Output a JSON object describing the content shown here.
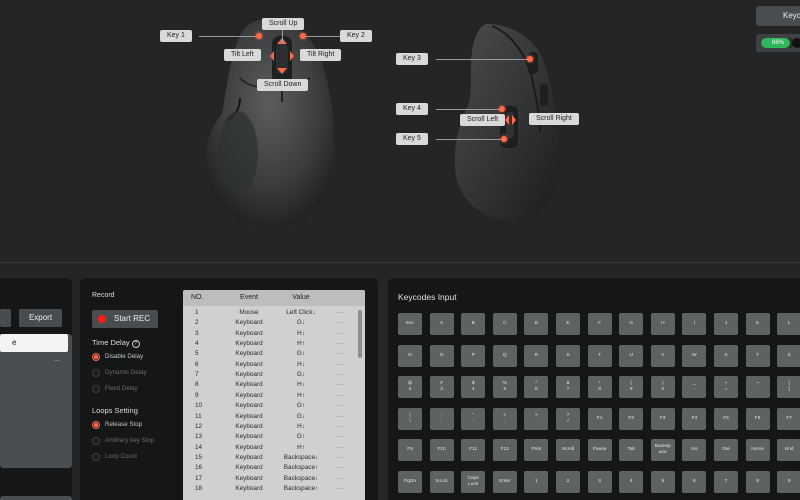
{
  "mouse_top": {
    "labels": {
      "scroll_up": "Scroll Up",
      "key1": "Key 1",
      "key2": "Key 2",
      "tilt_left": "Tilt Left",
      "tilt_right": "Tilt Right",
      "scroll_down": "Scroll Down"
    }
  },
  "mouse_side": {
    "labels": {
      "key3": "Key 3",
      "key4": "Key 4",
      "key5": "Key 5",
      "scroll_left": "Scroll Left",
      "scroll_right": "Scroll Right"
    }
  },
  "top_right": {
    "button_label": "Keyc",
    "battery": {
      "percent_text": "86%",
      "level": 0.86,
      "color": "#2eb85c"
    }
  },
  "left_panel": {
    "export_label": "Export",
    "selected_item": "e",
    "dots": "..."
  },
  "record": {
    "title": "Record",
    "start_label": "Start REC",
    "time_delay_title": "Time Delay",
    "time_delay_options": [
      "Disable Delay",
      "Dynamic Delay",
      "Fixed Delay"
    ],
    "loops_title": "Loops Setting",
    "loops_options": [
      "Release Stop",
      "Arbitrary key Stop",
      "Loop Count"
    ],
    "accent": "#ff6a4a"
  },
  "macro_table": {
    "headers": {
      "no": "NO.",
      "event": "Event",
      "value": "Value"
    },
    "rows": [
      {
        "no": "1",
        "event": "Mouse",
        "value": "Left Click↓",
        "more": "···"
      },
      {
        "no": "2",
        "event": "Keyboard",
        "value": "G↓",
        "more": "···"
      },
      {
        "no": "3",
        "event": "Keyboard",
        "value": "H↓",
        "more": "···"
      },
      {
        "no": "4",
        "event": "Keyboard",
        "value": "H↑",
        "more": "···"
      },
      {
        "no": "5",
        "event": "Keyboard",
        "value": "G↑",
        "more": "···"
      },
      {
        "no": "6",
        "event": "Keyboard",
        "value": "H↓",
        "more": "···"
      },
      {
        "no": "7",
        "event": "Keyboard",
        "value": "G↓",
        "more": "···"
      },
      {
        "no": "8",
        "event": "Keyboard",
        "value": "H↓",
        "more": "···"
      },
      {
        "no": "9",
        "event": "Keyboard",
        "value": "H↑",
        "more": "···"
      },
      {
        "no": "10",
        "event": "Keyboard",
        "value": "G↑",
        "more": "···"
      },
      {
        "no": "11",
        "event": "Keyboard",
        "value": "G↓",
        "more": "···"
      },
      {
        "no": "12",
        "event": "Keyboard",
        "value": "H↓",
        "more": "···"
      },
      {
        "no": "13",
        "event": "Keyboard",
        "value": "G↑",
        "more": "···"
      },
      {
        "no": "14",
        "event": "Keyboard",
        "value": "H↑",
        "more": "···"
      },
      {
        "no": "15",
        "event": "Keyboard",
        "value": "Backspace↓",
        "more": "···"
      },
      {
        "no": "16",
        "event": "Keyboard",
        "value": "Backspace↑",
        "more": "···"
      },
      {
        "no": "17",
        "event": "Keyboard",
        "value": "Backspace↓",
        "more": "···"
      },
      {
        "no": "18",
        "event": "Keyboard",
        "value": "Backspace↑",
        "more": "···"
      }
    ]
  },
  "keycodes": {
    "title": "Keycodes Input",
    "rows": [
      [
        "Esc",
        "A",
        "B",
        "C",
        "D",
        "E",
        "F",
        "G",
        "H",
        "I",
        "J",
        "K",
        "L"
      ],
      [
        "N",
        "O",
        "P",
        "Q",
        "R",
        "S",
        "T",
        "U",
        "V",
        "W",
        "X",
        "Y",
        "Z"
      ],
      [
        "@\n2",
        "#\n3",
        "$\n4",
        "%\n5",
        "^\n6",
        "&\n7",
        "*\n8",
        "(\n9",
        ")\n0",
        "_\n-",
        "+\n=",
        "~\n`",
        "{\n["
      ],
      [
        "|\n\\",
        ":\n;",
        "\"\n'",
        "<\n,",
        ">\n.",
        "?\n/",
        "F1",
        "F2",
        "F3",
        "F4",
        "F5",
        "F6",
        "F7"
      ],
      [
        "F9",
        "F10",
        "F11",
        "F12",
        "Print",
        "Scroll",
        "Pause",
        "Tab",
        "Backsp\nace",
        "Ins",
        "Del",
        "Home",
        "End"
      ],
      [
        "PgDn",
        "N.Lck",
        "Caps\nLock",
        "Enter",
        "1",
        "2",
        "3",
        "4",
        "5",
        "6",
        "7",
        "8",
        "9"
      ]
    ]
  }
}
